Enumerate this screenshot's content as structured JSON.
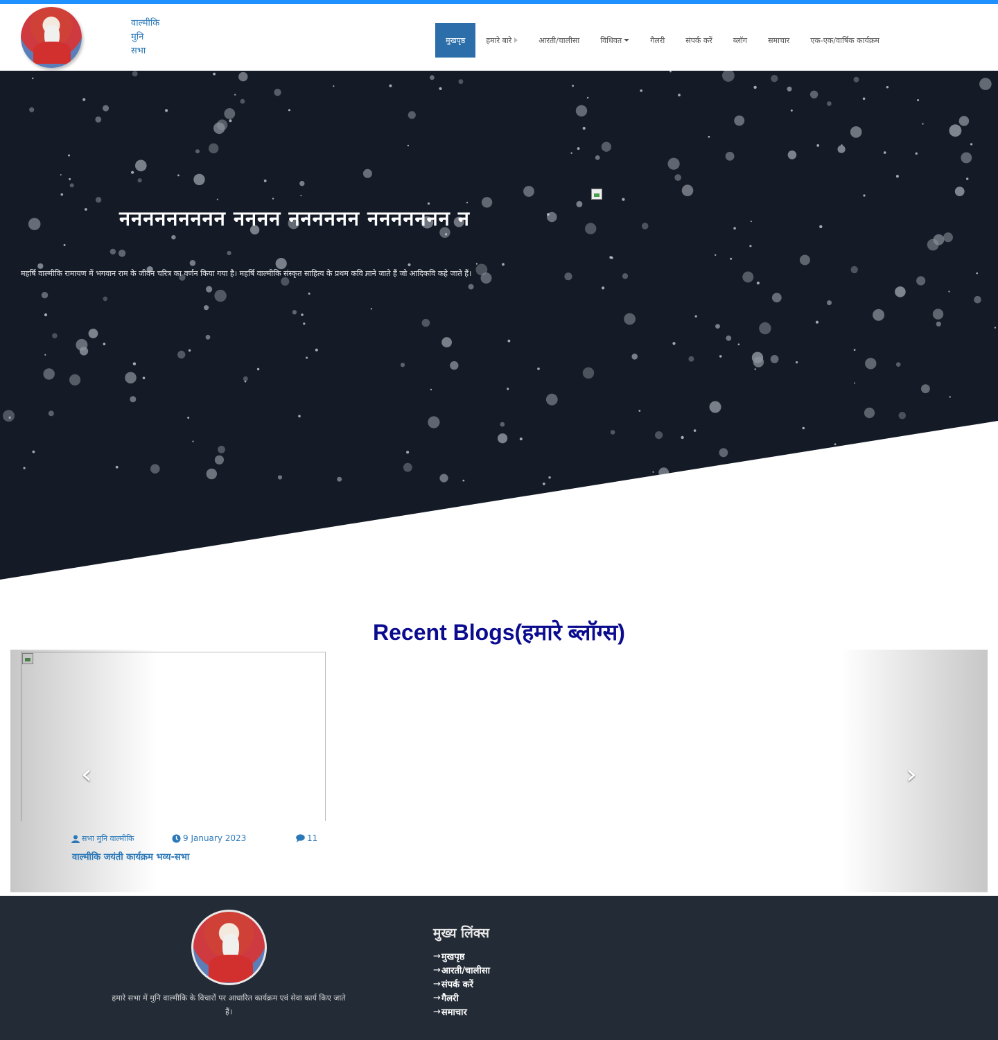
{
  "header": {
    "brand_lines": [
      "वाल्मीकि",
      "मुनि",
      "सभा"
    ],
    "nav": [
      {
        "label": "मुखपृष्ठ",
        "active": true
      },
      {
        "label": "हमारे बारे",
        "active": false,
        "submenu_arrow": true
      },
      {
        "label": "आरती/चालीसा",
        "active": false
      },
      {
        "label": "विधिवत",
        "active": false,
        "dropdown": true
      },
      {
        "label": "गैलरी",
        "active": false
      },
      {
        "label": "संपर्क करें",
        "active": false
      },
      {
        "label": "ब्लॉग",
        "active": false
      },
      {
        "label": "समाचार",
        "active": false
      },
      {
        "label": "एक-एक/वार्षिक कार्यक्रम",
        "active": false
      }
    ]
  },
  "hero": {
    "title": "ननननननननन नननन नननननन ननननननन न",
    "text": "महर्षि वाल्मीकि रामायण में भगवान राम के जीवन चरित्र का वर्णन किया गया है। महर्षि वाल्मीकि संस्कृत साहित्य के प्रथम कवि माने जाते हैं जो आदिकवि कहे जाते हैं।"
  },
  "blogs": {
    "title": "Recent Blogs(हमारे ब्लॉग्स)",
    "prev_symbol": "‹",
    "next_symbol": "›",
    "posts": [
      {
        "author": "सभा मुनि वाल्मीकि",
        "date": "9 January 2023",
        "comments": "11",
        "title": "वाल्मीकि जयंती कार्यक्रम भव्य-सभा"
      }
    ]
  },
  "footer": {
    "description": "हमारे सभा में मुनि वाल्मीकि के विचारों पर आधारित कार्यक्रम एवं सेवा कार्य किए जाते हैं।",
    "links_heading": "मुख्य लिंक्स",
    "links": [
      "मुखपृष्ठ",
      "आरती/चालीसा",
      "संपर्क करें",
      "गैलरी",
      "समाचार"
    ],
    "arrow_symbol": "→"
  },
  "colors": {
    "accent": "#1e90ff",
    "nav_active": "#2b6ea9",
    "link": "#2b78b8",
    "hero_bg": "#141b27",
    "section_title": "#0b0b8f",
    "footer_bg": "#232b36"
  }
}
